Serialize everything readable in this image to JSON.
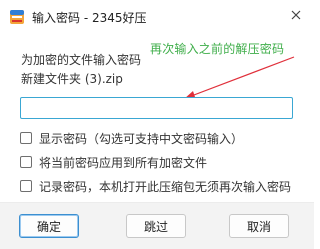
{
  "window": {
    "title": "输入密码 - 2345好压",
    "app_icon": "haozip-app-icon",
    "close_icon": "close-icon"
  },
  "body": {
    "prompt": "为加密的文件输入密码",
    "filename": "新建文件夹 (3).zip",
    "annotation": "再次输入之前的解压密码"
  },
  "password_field": {
    "value": "",
    "placeholder": ""
  },
  "options": [
    {
      "label": "显示密码（勾选可支持中文密码输入）",
      "checked": false
    },
    {
      "label": "将当前密码应用到所有加密文件",
      "checked": false
    },
    {
      "label": "记录密码，本机打开此压缩包无须再次输入密码",
      "checked": false
    }
  ],
  "buttons": {
    "ok": "确定",
    "skip": "跳过",
    "cancel": "取消"
  },
  "colors": {
    "annotation": "#3fae4a",
    "arrow": "#e0303b",
    "input_border": "#3aa7d3",
    "primary_button_border": "#3c8fd0"
  }
}
